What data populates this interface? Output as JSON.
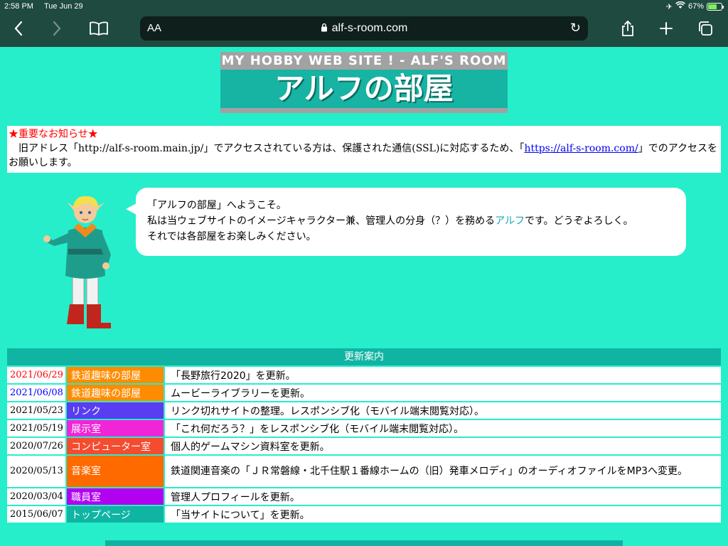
{
  "status": {
    "time": "2:58 PM",
    "date": "Tue Jun 29",
    "battery": "67%",
    "battery_level": 0.67
  },
  "toolbar": {
    "aa": "AA",
    "url": "alf-s-room.com"
  },
  "banner": {
    "top_text": "MY HOBBY WEB SITE ! - ALF'S ROOM",
    "title": "アルフの部屋"
  },
  "notice": {
    "head": "★重要なお知らせ★",
    "text_before": "　旧アドレス「http://alf-s-room.main.jp/」でアクセスされている方は、保護された通信(SSL)に対応するため、「",
    "link": "https://alf-s-room.com/",
    "text_after": "」でのアクセスをお願いします。"
  },
  "greeting": {
    "line1": "「アルフの部屋」へようこそ。",
    "line2_before": "私は当ウェブサイトのイメージキャラクター兼、管理人の分身（？）を務める",
    "line2_name": "アルフ",
    "line2_after": "です。どうぞよろしく。",
    "line3": "それでは各部屋をお楽しみください。"
  },
  "updates": {
    "caption": "更新案内",
    "rows": [
      {
        "date": "2021/06/29",
        "date_color": "#ff0000",
        "category": "鉄道趣味の部屋",
        "cat_color": "#ff8c00",
        "text": "「長野旅行2020」を更新。"
      },
      {
        "date": "2021/06/08",
        "date_color": "#0000ff",
        "category": "鉄道趣味の部屋",
        "cat_color": "#ff8c00",
        "text": "ムービーライブラリーを更新。"
      },
      {
        "date": "2021/05/23",
        "date_color": "#000000",
        "category": "リンク",
        "cat_color": "#5a3df2",
        "text": "リンク切れサイトの整理。レスポンシブ化（モバイル端末閲覧対応）。"
      },
      {
        "date": "2021/05/19",
        "date_color": "#000000",
        "category": "展示室",
        "cat_color": "#f025d8",
        "text": "「これ何だろう？」をレスポンシブ化（モバイル端末閲覧対応）。"
      },
      {
        "date": "2020/07/26",
        "date_color": "#000000",
        "category": "コンピューター室",
        "cat_color": "#f54b2f",
        "text": "個人的ゲームマシン資料室を更新。"
      },
      {
        "date": "2020/05/13",
        "date_color": "#000000",
        "category": "音楽室",
        "cat_color": "#ff6a00",
        "text": "鉄道関連音楽の「ＪＲ常磐線・北千住駅１番線ホームの（旧）発車メロディ」のオーディオファイルをMP3へ変更。"
      },
      {
        "date": "2020/03/04",
        "date_color": "#000000",
        "category": "職員室",
        "cat_color": "#b200f0",
        "text": "管理人プロフィールを更新。"
      },
      {
        "date": "2015/06/07",
        "date_color": "#000000",
        "category": "トップページ",
        "cat_color": "#10b4a3",
        "text": "「当サイトについて」を更新。"
      }
    ]
  }
}
